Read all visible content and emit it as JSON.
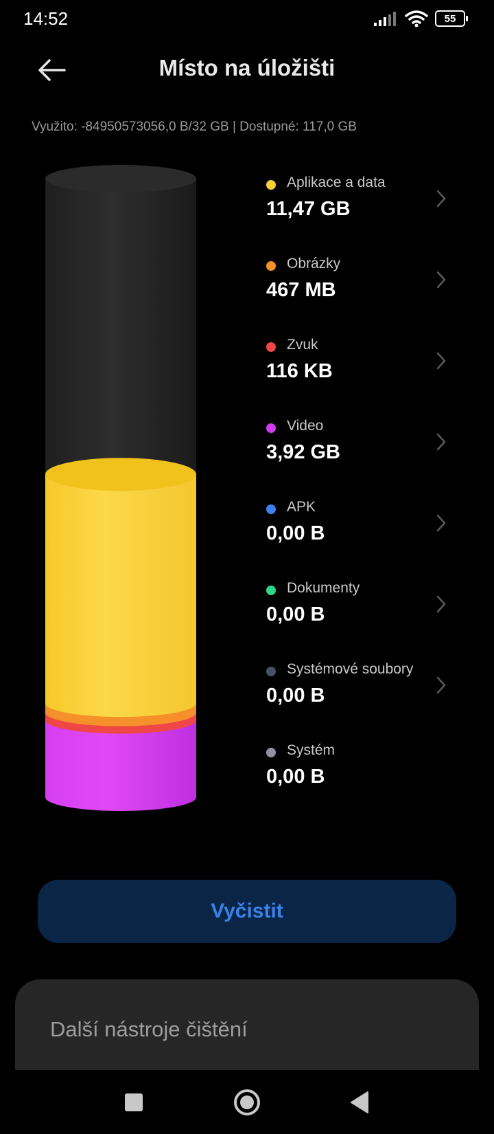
{
  "status_bar": {
    "time": "14:52",
    "battery": "55",
    "icons": [
      "signal-icon",
      "wifi-icon",
      "battery-icon"
    ]
  },
  "header": {
    "title": "Místo na úložišti",
    "back_icon": "arrow-left-icon"
  },
  "summary": "Využito: -84950573056,0 B/32 GB | Dostupné: 117,0 GB",
  "storage_segments": [
    {
      "name": "Aplikace a data",
      "fraction": 0.37,
      "color": "#f8cf35"
    },
    {
      "name": "Obrázky",
      "fraction": 0.015,
      "color": "#f5902a"
    },
    {
      "name": "Zvuk",
      "fraction": 0.012,
      "color": "#ef4747"
    },
    {
      "name": "Video",
      "fraction": 0.125,
      "color": "#cf3cf0"
    }
  ],
  "categories": [
    {
      "label": "Aplikace a data",
      "value": "11,47 GB",
      "color": "#f8cf35",
      "chevron": true
    },
    {
      "label": "Obrázky",
      "value": "467 MB",
      "color": "#f5902a",
      "chevron": true
    },
    {
      "label": "Zvuk",
      "value": "116 KB",
      "color": "#ef4747",
      "chevron": true
    },
    {
      "label": "Video",
      "value": "3,92 GB",
      "color": "#cf3cf0",
      "chevron": true
    },
    {
      "label": "APK",
      "value": "0,00 B",
      "color": "#3b82ee",
      "chevron": true
    },
    {
      "label": "Dokumenty",
      "value": "0,00 B",
      "color": "#2dd68a",
      "chevron": true
    },
    {
      "label": "Systémové soubory",
      "value": "0,00 B",
      "color": "#4a5068",
      "chevron": true
    },
    {
      "label": "Systém",
      "value": "0,00 B",
      "color": "#8e92a4",
      "chevron": false
    }
  ],
  "clean_button": "Vyčistit",
  "more_tools": {
    "title": "Další nástroje čištění"
  },
  "nav": {
    "recents_icon": "square-icon",
    "home_icon": "circle-icon",
    "back_icon": "triangle-back-icon"
  }
}
